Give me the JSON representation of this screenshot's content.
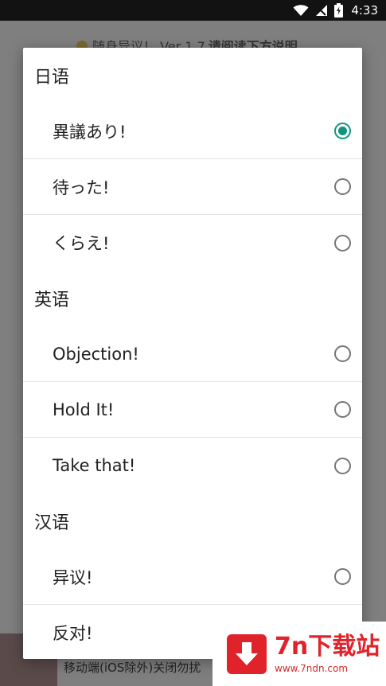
{
  "status_bar": {
    "time": "4:33"
  },
  "background": {
    "title_plain": "随身异议！ Ver 1.7",
    "title_bold": "请阅读下方说明",
    "footer_text": "移动端(iOS除外)关闭勿扰"
  },
  "dialog": {
    "groups": [
      {
        "label": "日语",
        "options": [
          {
            "label": "異議あり!",
            "selected": true
          },
          {
            "label": "待った!",
            "selected": false
          },
          {
            "label": "くらえ!",
            "selected": false
          }
        ]
      },
      {
        "label": "英语",
        "options": [
          {
            "label": "Objection!",
            "selected": false
          },
          {
            "label": "Hold It!",
            "selected": false
          },
          {
            "label": "Take that!",
            "selected": false
          }
        ]
      },
      {
        "label": "汉语",
        "options": [
          {
            "label": "异议!",
            "selected": false
          },
          {
            "label": "反对!",
            "selected": false
          }
        ]
      }
    ]
  },
  "watermark": {
    "title": "7n下载站",
    "url": "www.7ndn.com"
  },
  "colors": {
    "accent": "#11947f",
    "watermark_red": "#e0232a"
  }
}
